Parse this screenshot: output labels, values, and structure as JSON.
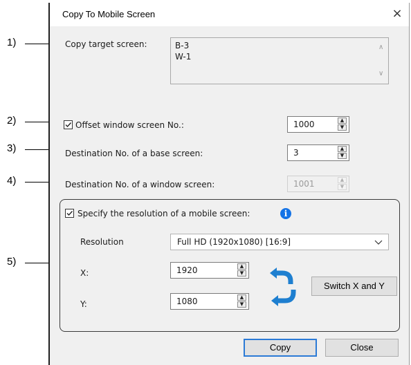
{
  "callouts": [
    "1)",
    "2)",
    "3)",
    "4)",
    "5)"
  ],
  "dialog": {
    "title": "Copy To Mobile Screen",
    "close_glyph": "×"
  },
  "copy_target": {
    "label": "Copy target screen:",
    "items": [
      "B-3",
      "W-1"
    ]
  },
  "offset_window": {
    "label": "Offset window screen No.:",
    "checked": true,
    "value": "1000"
  },
  "dest_base": {
    "label": "Destination No. of a base screen:",
    "value": "3"
  },
  "dest_window": {
    "label": "Destination No. of a window screen:",
    "value": "1001",
    "disabled": true
  },
  "resolution_group": {
    "checkbox_label": "Specify the resolution of a mobile screen:",
    "checked": true,
    "info_icon": "info-icon",
    "resolution_label": "Resolution",
    "resolution_value": "Full HD (1920x1080) [16:9]",
    "x_label": "X:",
    "x_value": "1920",
    "y_label": "Y:",
    "y_value": "1080",
    "switch_label": "Switch X and Y",
    "swap_icon": "swap-arrows-icon"
  },
  "footer": {
    "copy_label": "Copy",
    "close_label": "Close"
  },
  "colors": {
    "accent": "#2b7ad6",
    "info": "#1473e6",
    "swap_arrow": "#1e7fd0"
  }
}
